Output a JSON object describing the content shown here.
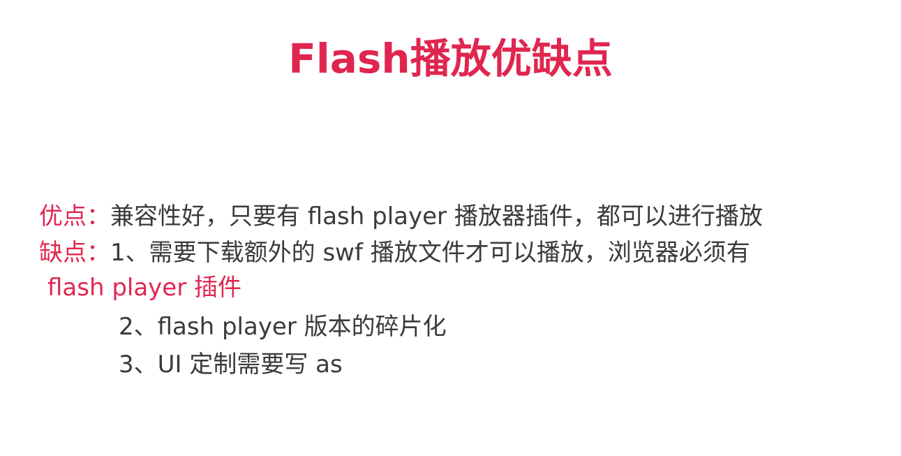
{
  "slide": {
    "title": "Flash播放优缺点",
    "pros": {
      "label": "优点：",
      "text": "兼容性好，只要有 flash player 播放器插件，都可以进行播放"
    },
    "cons": {
      "label": "缺点：",
      "item1": "1、需要下载额外的 swf 播放文件才可以播放，浏览器必须有",
      "item1_continued": "flash player 插件",
      "item2": "2、flash player 版本的碎片化",
      "item3": "3、UI 定制需要写 as"
    }
  },
  "colors": {
    "accent": "#e0264f",
    "body_text": "#3a3a3a",
    "background": "#ffffff"
  }
}
